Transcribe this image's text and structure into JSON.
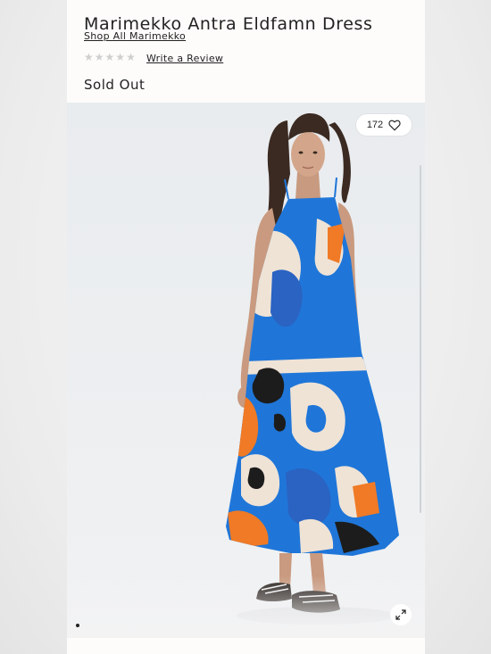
{
  "product": {
    "title": "Marimekko Antra Eldfamn Dress",
    "shop_link": "Shop All Marimekko",
    "rating_stars": 0,
    "rating_max": 5,
    "review_link": "Write a Review",
    "availability": "Sold Out"
  },
  "gallery": {
    "likes": "172",
    "image_index": 1,
    "image_count": 1
  },
  "icons": {
    "like": "heart-icon",
    "expand": "expand-icon",
    "star": "star-icon"
  },
  "colors": {
    "dress_blue": "#1f76d8",
    "dress_orange": "#f07a25",
    "dress_cream": "#efe3d6",
    "text": "#222222"
  }
}
